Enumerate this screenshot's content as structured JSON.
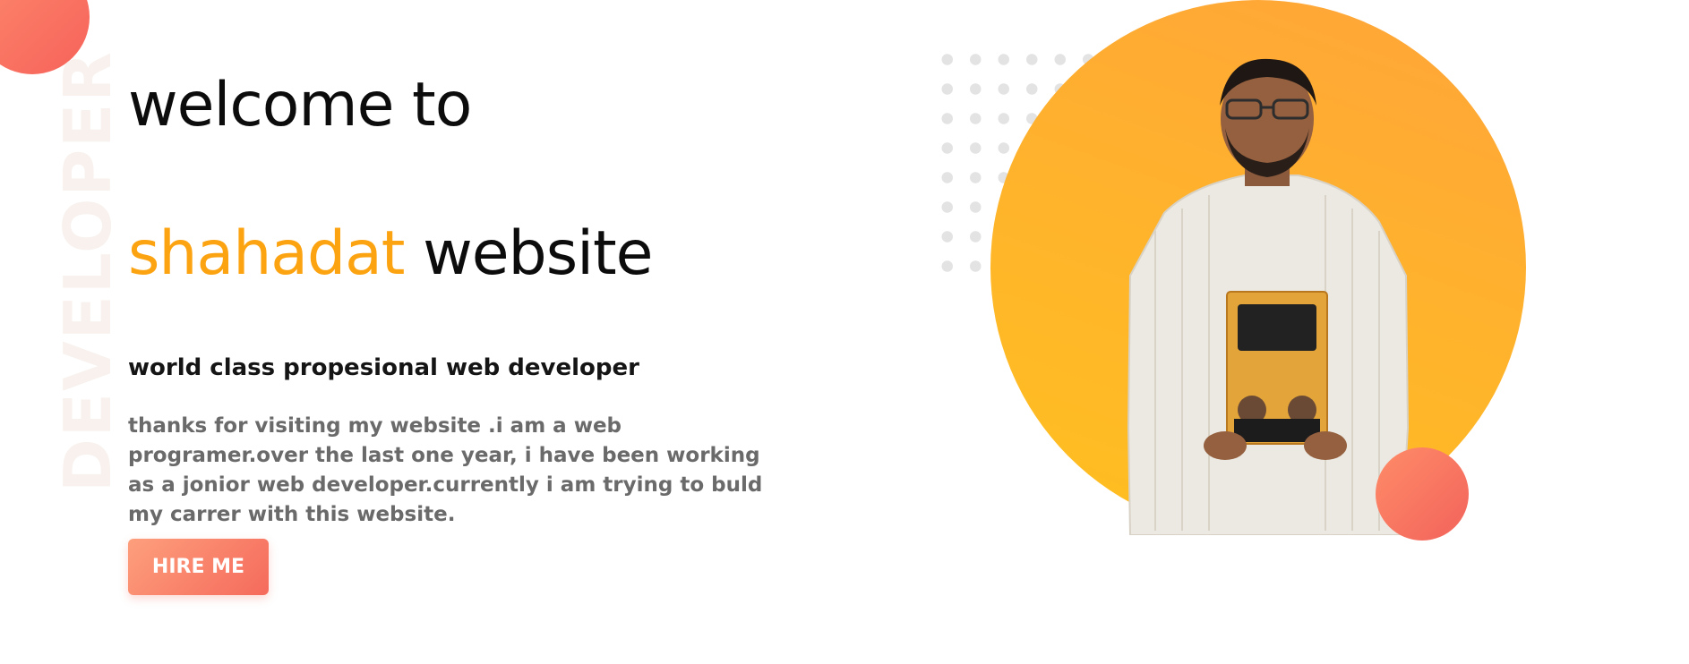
{
  "hero": {
    "side_word": "DEVELOPER",
    "headline_line1": "welcome to",
    "headline_name": "shahadat",
    "headline_rest": " website",
    "subtitle": "world class propesional web developer",
    "intro": "thanks for visiting my website .i am a web programer.over the last one year, i have been working as a jonior web developer.currently i am trying to buld my carrer with this website.",
    "hire_button": "HIRE ME"
  },
  "colors": {
    "accent": "#fca311",
    "coral": "#f56a5c",
    "photo_circle": "#ffb22d"
  }
}
